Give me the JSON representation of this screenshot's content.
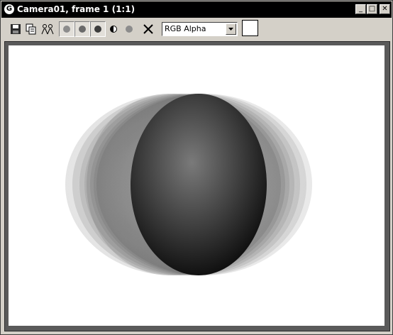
{
  "window": {
    "title": "Camera01, frame 1 (1:1)",
    "controls": {
      "minimize": "_",
      "maximize": "□",
      "close": "✕"
    }
  },
  "toolbar": {
    "tools": [
      {
        "icon": "save-icon"
      },
      {
        "icon": "copy-icon"
      },
      {
        "icon": "clone-icon"
      }
    ],
    "channels": [
      {
        "icon": "red-channel-icon",
        "color": "#8c8c8c",
        "active": true
      },
      {
        "icon": "green-channel-icon",
        "color": "#6a6a6a",
        "active": true
      },
      {
        "icon": "blue-channel-icon",
        "color": "#3c3c3c",
        "active": true
      },
      {
        "icon": "monochrome-icon"
      },
      {
        "icon": "alpha-channel-icon",
        "color": "#8c8c8c"
      }
    ],
    "clear_icon": "clear-x-icon",
    "display_channel": "RGB Alpha",
    "swatch_color": "#ffffff"
  },
  "render": {
    "background": "#ffffff",
    "description_icon": "motion-blurred-sphere"
  }
}
